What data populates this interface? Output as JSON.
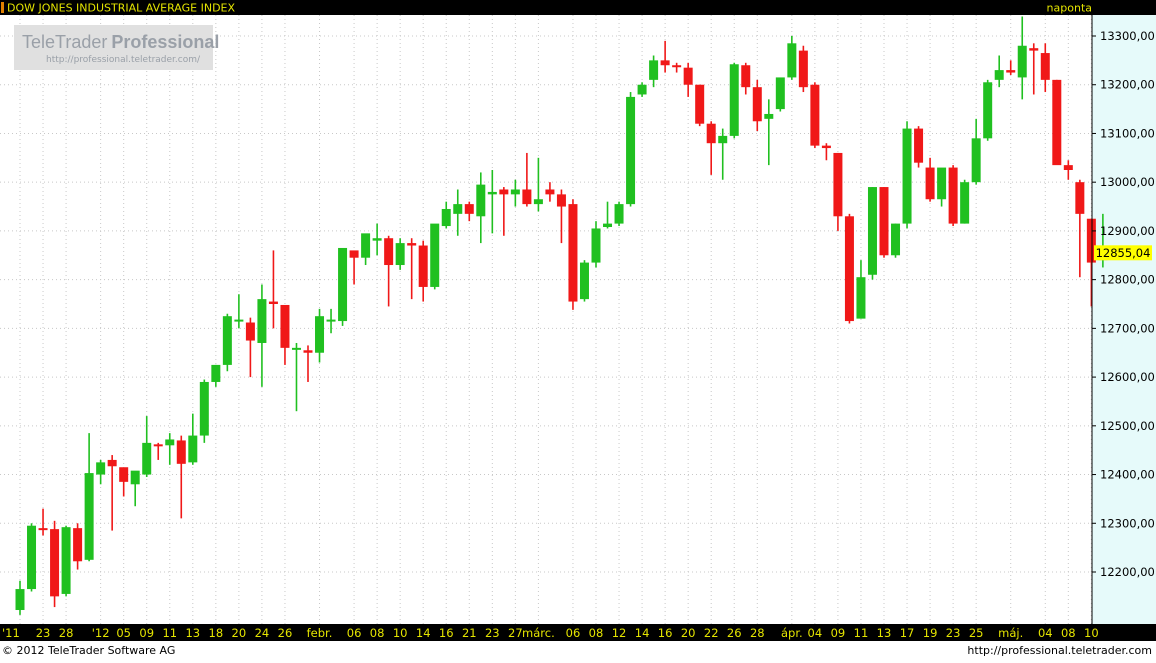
{
  "header": {
    "instrument_title": "DOW JONES INDUSTRIAL AVERAGE INDEX",
    "period_label": "naponta"
  },
  "watermark": {
    "brand_plain": "TeleTrader",
    "brand_bold": "Professional",
    "url": "http://professional.teletrader.com/"
  },
  "footer": {
    "copyright": "© 2012 TeleTrader Software AG",
    "url": "http://professional.teletrader.com"
  },
  "colors": {
    "background": "#ffffff",
    "plot_background": "#ffffff",
    "right_axis_background": "#e6fafa",
    "header_background": "#000000",
    "header_text": "#e4e400",
    "up_candle": "#20c020",
    "down_candle": "#f01818",
    "last_price_marker": "#ffff00",
    "grid": "#c8c8c8",
    "axis_bar": "#000000",
    "axis_text": "#e4e400"
  },
  "chart_data": {
    "type": "candlestick",
    "title": "DOW JONES INDUSTRIAL AVERAGE INDEX",
    "interval": "naponta",
    "ylim": [
      12100,
      13340
    ],
    "y_ticks": [
      12200,
      12300,
      12400,
      12500,
      12600,
      12700,
      12800,
      12900,
      13000,
      13100,
      13200,
      13300
    ],
    "y_tick_labels": [
      "12200,00",
      "12300,00",
      "12400,00",
      "12500,00",
      "12600,00",
      "12700,00",
      "12800,00",
      "12900,00",
      "13000,00",
      "13100,00",
      "13200,00",
      "13300,00"
    ],
    "last_price": 12855.04,
    "last_price_label": "12855,04",
    "grid": true,
    "x_labels": [
      {
        "i": 0,
        "label": "'11"
      },
      {
        "i": 2,
        "label": "23"
      },
      {
        "i": 4,
        "label": "28"
      },
      {
        "i": 7,
        "label": "'12"
      },
      {
        "i": 9,
        "label": "05"
      },
      {
        "i": 11,
        "label": "09"
      },
      {
        "i": 13,
        "label": "11"
      },
      {
        "i": 15,
        "label": "13"
      },
      {
        "i": 17,
        "label": "18"
      },
      {
        "i": 19,
        "label": "20"
      },
      {
        "i": 21,
        "label": "24"
      },
      {
        "i": 23,
        "label": "26"
      },
      {
        "i": 26,
        "label": "febr."
      },
      {
        "i": 29,
        "label": "06"
      },
      {
        "i": 31,
        "label": "08"
      },
      {
        "i": 33,
        "label": "10"
      },
      {
        "i": 35,
        "label": "14"
      },
      {
        "i": 37,
        "label": "16"
      },
      {
        "i": 39,
        "label": "21"
      },
      {
        "i": 41,
        "label": "23"
      },
      {
        "i": 43,
        "label": "27"
      },
      {
        "i": 45,
        "label": "márc."
      },
      {
        "i": 48,
        "label": "06"
      },
      {
        "i": 50,
        "label": "08"
      },
      {
        "i": 52,
        "label": "12"
      },
      {
        "i": 54,
        "label": "14"
      },
      {
        "i": 56,
        "label": "16"
      },
      {
        "i": 58,
        "label": "20"
      },
      {
        "i": 60,
        "label": "22"
      },
      {
        "i": 62,
        "label": "26"
      },
      {
        "i": 64,
        "label": "28"
      },
      {
        "i": 67,
        "label": "ápr."
      },
      {
        "i": 69,
        "label": "04"
      },
      {
        "i": 71,
        "label": "09"
      },
      {
        "i": 73,
        "label": "11"
      },
      {
        "i": 75,
        "label": "13"
      },
      {
        "i": 77,
        "label": "17"
      },
      {
        "i": 79,
        "label": "19"
      },
      {
        "i": 81,
        "label": "23"
      },
      {
        "i": 83,
        "label": "25"
      },
      {
        "i": 86,
        "label": "máj."
      },
      {
        "i": 89,
        "label": "04"
      },
      {
        "i": 91,
        "label": "08"
      },
      {
        "i": 93,
        "label": "10"
      }
    ],
    "ohlc": [
      [
        12122,
        12182,
        12112,
        12165
      ],
      [
        12165,
        12300,
        12160,
        12295
      ],
      [
        12290,
        12330,
        12275,
        12287
      ],
      [
        12288,
        12305,
        12128,
        12150
      ],
      [
        12155,
        12295,
        12150,
        12292
      ],
      [
        12290,
        12300,
        12205,
        12222
      ],
      [
        12225,
        12485,
        12222,
        12403
      ],
      [
        12400,
        12430,
        12380,
        12425
      ],
      [
        12430,
        12440,
        12285,
        12417
      ],
      [
        12415,
        12412,
        12355,
        12385
      ],
      [
        12380,
        12405,
        12335,
        12408
      ],
      [
        12400,
        12520,
        12395,
        12465
      ],
      [
        12462,
        12465,
        12430,
        12458
      ],
      [
        12460,
        12485,
        12420,
        12472
      ],
      [
        12470,
        12480,
        12310,
        12422
      ],
      [
        12425,
        12525,
        12420,
        12480
      ],
      [
        12480,
        12595,
        12465,
        12590
      ],
      [
        12590,
        12625,
        12580,
        12625
      ],
      [
        12625,
        12730,
        12612,
        12725
      ],
      [
        12718,
        12770,
        12700,
        12718
      ],
      [
        12712,
        12722,
        12600,
        12675
      ],
      [
        12670,
        12790,
        12580,
        12760
      ],
      [
        12755,
        12860,
        12700,
        12750
      ],
      [
        12748,
        12740,
        12625,
        12660
      ],
      [
        12658,
        12670,
        12530,
        12660
      ],
      [
        12655,
        12665,
        12590,
        12650
      ],
      [
        12650,
        12740,
        12630,
        12725
      ],
      [
        12718,
        12740,
        12690,
        12718
      ],
      [
        12715,
        12810,
        12705,
        12865
      ],
      [
        12860,
        12855,
        12790,
        12845
      ],
      [
        12845,
        12885,
        12830,
        12895
      ],
      [
        12880,
        12915,
        12850,
        12885
      ],
      [
        12885,
        12890,
        12745,
        12830
      ],
      [
        12830,
        12885,
        12820,
        12875
      ],
      [
        12875,
        12885,
        12760,
        12870
      ],
      [
        12870,
        12880,
        12755,
        12785
      ],
      [
        12785,
        12910,
        12780,
        12915
      ],
      [
        12910,
        12960,
        12905,
        12945
      ],
      [
        12935,
        12985,
        12890,
        12955
      ],
      [
        12955,
        12960,
        12920,
        12935
      ],
      [
        12930,
        13020,
        12875,
        12995
      ],
      [
        12975,
        13025,
        12895,
        12980
      ],
      [
        12985,
        12990,
        12890,
        12975
      ],
      [
        12975,
        13005,
        12950,
        12985
      ],
      [
        12985,
        13060,
        12950,
        12955
      ],
      [
        12955,
        13050,
        12940,
        12965
      ],
      [
        12985,
        13000,
        12960,
        12975
      ],
      [
        12975,
        12985,
        12875,
        12950
      ],
      [
        12955,
        12965,
        12738,
        12755
      ],
      [
        12760,
        12840,
        12755,
        12835
      ],
      [
        12835,
        12920,
        12825,
        12905
      ],
      [
        12908,
        12960,
        12905,
        12915
      ],
      [
        12915,
        12960,
        12910,
        12955
      ],
      [
        12955,
        13185,
        12950,
        13175
      ],
      [
        13180,
        13205,
        13175,
        13200
      ],
      [
        13210,
        13260,
        13195,
        13250
      ],
      [
        13250,
        13290,
        13225,
        13240
      ],
      [
        13240,
        13245,
        13225,
        13238
      ],
      [
        13235,
        13245,
        13175,
        13200
      ],
      [
        13200,
        13200,
        13115,
        13120
      ],
      [
        13120,
        13125,
        13015,
        13080
      ],
      [
        13080,
        13110,
        13005,
        13095
      ],
      [
        13095,
        13245,
        13090,
        13242
      ],
      [
        13240,
        13245,
        13180,
        13195
      ],
      [
        13195,
        13210,
        13105,
        13125
      ],
      [
        13130,
        13170,
        13035,
        13140
      ],
      [
        13150,
        13200,
        13145,
        13215
      ],
      [
        13215,
        13300,
        13210,
        13285
      ],
      [
        13270,
        13280,
        13185,
        13195
      ],
      [
        13200,
        13205,
        13070,
        13075
      ],
      [
        13075,
        13080,
        13045,
        13070
      ],
      [
        13060,
        13060,
        12900,
        12930
      ],
      [
        12930,
        12935,
        12710,
        12715
      ],
      [
        12720,
        12840,
        12720,
        12805
      ],
      [
        12810,
        12990,
        12800,
        12990
      ],
      [
        12990,
        12990,
        12845,
        12850
      ],
      [
        12850,
        12915,
        12845,
        12915
      ],
      [
        12915,
        13125,
        12905,
        13110
      ],
      [
        13110,
        13115,
        13030,
        13040
      ],
      [
        13030,
        13050,
        12960,
        12965
      ],
      [
        12965,
        13025,
        12950,
        13030
      ],
      [
        13030,
        13035,
        12910,
        12915
      ],
      [
        12915,
        13005,
        12915,
        13000
      ],
      [
        13000,
        13130,
        12995,
        13090
      ],
      [
        13090,
        13210,
        13085,
        13205
      ],
      [
        13210,
        13260,
        13195,
        13230
      ],
      [
        13230,
        13250,
        13220,
        13225
      ],
      [
        13215,
        13340,
        13170,
        13280
      ],
      [
        13275,
        13285,
        13180,
        13270
      ],
      [
        13265,
        13285,
        13185,
        13210
      ],
      [
        13210,
        13210,
        13040,
        13035
      ],
      [
        13035,
        13045,
        13005,
        13025
      ],
      [
        13000,
        13005,
        12805,
        12935
      ],
      [
        12925,
        12925,
        12745,
        12835
      ],
      [
        12840,
        12935,
        12825,
        12855
      ]
    ]
  }
}
